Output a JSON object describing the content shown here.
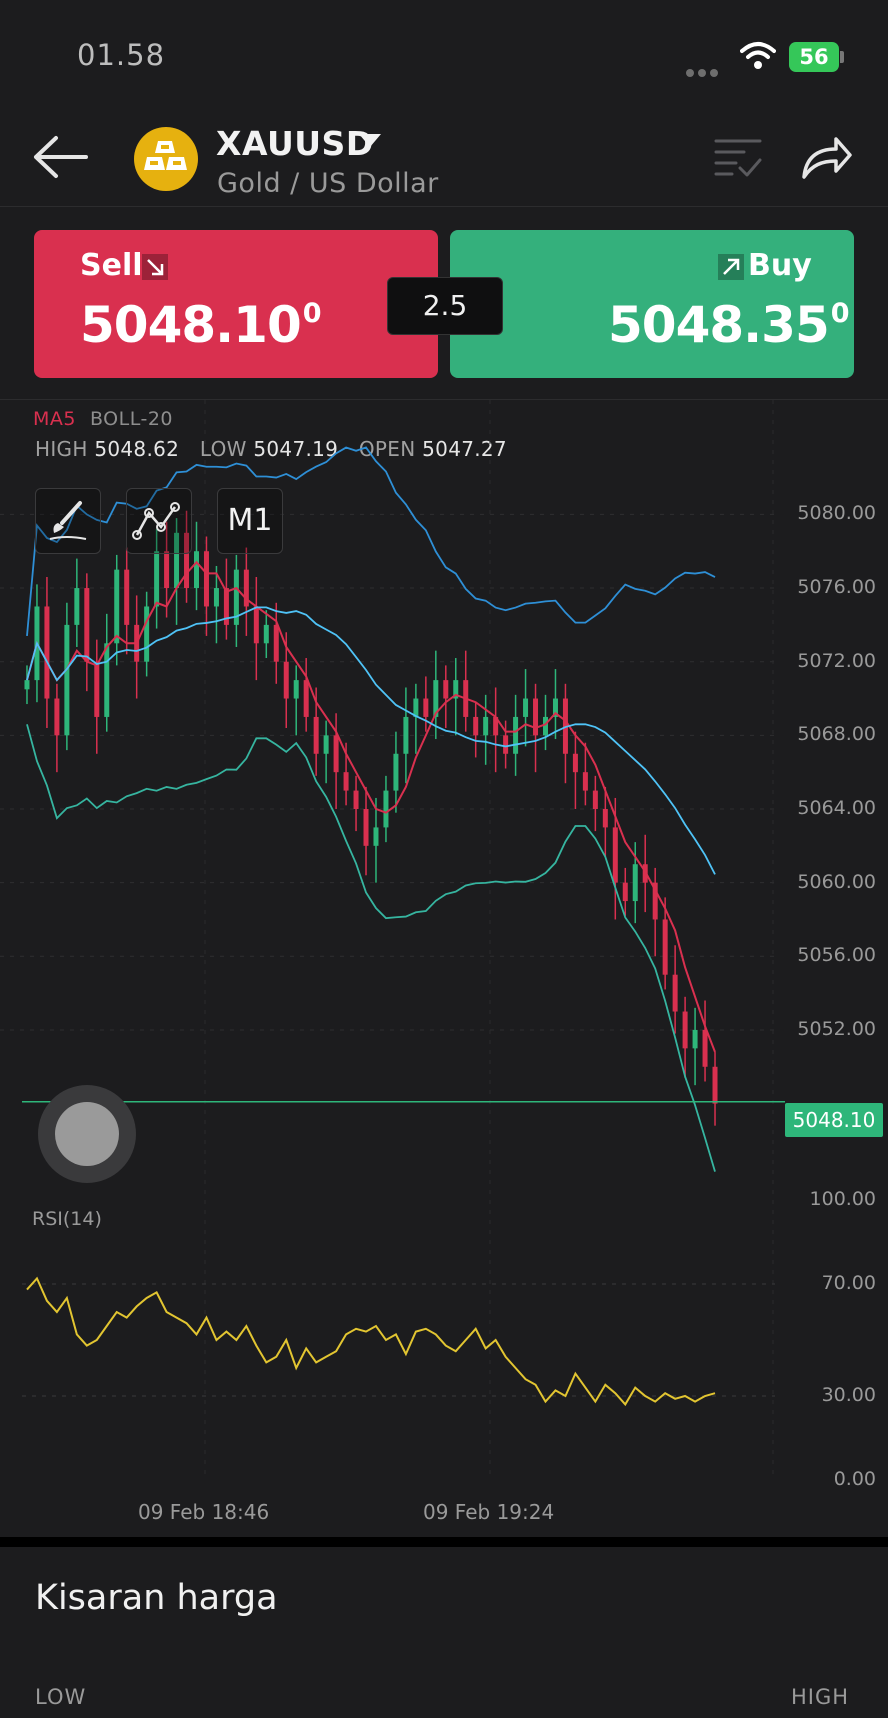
{
  "status_bar": {
    "time": "01.58",
    "battery": "56"
  },
  "header": {
    "symbol": "XAUUSD",
    "subtitle": "Gold / US Dollar"
  },
  "trade": {
    "sell_label": "Sell",
    "sell_price": "5048.10",
    "sell_price_sup": "0",
    "buy_label": "Buy",
    "buy_price": "5048.35",
    "buy_price_sup": "0",
    "spread": "2.5"
  },
  "indicators": {
    "ma": "MA5",
    "boll": "BOLL-20"
  },
  "ohlc": {
    "high_label": "HIGH",
    "high": "5048.62",
    "low_label": "LOW",
    "low": "5047.19",
    "open_label": "OPEN",
    "open": "5047.27"
  },
  "tools": {
    "timeframe": "M1"
  },
  "chart_data": {
    "type": "candlestick",
    "y_axis_labels": [
      "5080.00",
      "5076.00",
      "5072.00",
      "5068.00",
      "5064.00",
      "5060.00",
      "5056.00",
      "5052.00"
    ],
    "ylim": [
      5047,
      5081
    ],
    "current_price": "5048.10",
    "x_labels": [
      "09 Feb 18:46",
      "09 Feb 19:24"
    ],
    "close": [
      5071,
      5075,
      5070,
      5068,
      5074,
      5076,
      5072,
      5069,
      5073,
      5077,
      5074,
      5072,
      5075,
      5078,
      5076,
      5079,
      5076,
      5078,
      5075,
      5076,
      5074,
      5077,
      5075,
      5073,
      5074,
      5072,
      5070,
      5071,
      5069,
      5067,
      5068,
      5066,
      5065,
      5064,
      5062,
      5063,
      5065,
      5067,
      5069,
      5070,
      5069,
      5071,
      5070,
      5071,
      5069,
      5068,
      5069,
      5068,
      5067,
      5069,
      5070,
      5068,
      5069,
      5070,
      5067,
      5066,
      5065,
      5064,
      5063,
      5060,
      5059,
      5061,
      5060,
      5058,
      5055,
      5053,
      5051,
      5052,
      5050,
      5048
    ],
    "rsi": {
      "label": "RSI(14)",
      "levels": [
        "100.00",
        "70.00",
        "30.00",
        "0.00"
      ],
      "values": [
        68,
        72,
        64,
        60,
        65,
        52,
        48,
        50,
        55,
        60,
        58,
        62,
        65,
        67,
        60,
        58,
        56,
        52,
        58,
        50,
        53,
        50,
        55,
        48,
        42,
        44,
        50,
        40,
        47,
        42,
        44,
        46,
        52,
        54,
        53,
        55,
        50,
        52,
        45,
        53,
        54,
        52,
        48,
        46,
        50,
        54,
        47,
        50,
        44,
        40,
        36,
        34,
        28,
        32,
        30,
        38,
        33,
        28,
        34,
        31,
        27,
        33,
        30,
        28,
        31,
        29,
        30,
        28,
        30,
        31
      ]
    }
  },
  "range": {
    "title": "Kisaran harga",
    "low": "LOW",
    "high": "HIGH"
  }
}
